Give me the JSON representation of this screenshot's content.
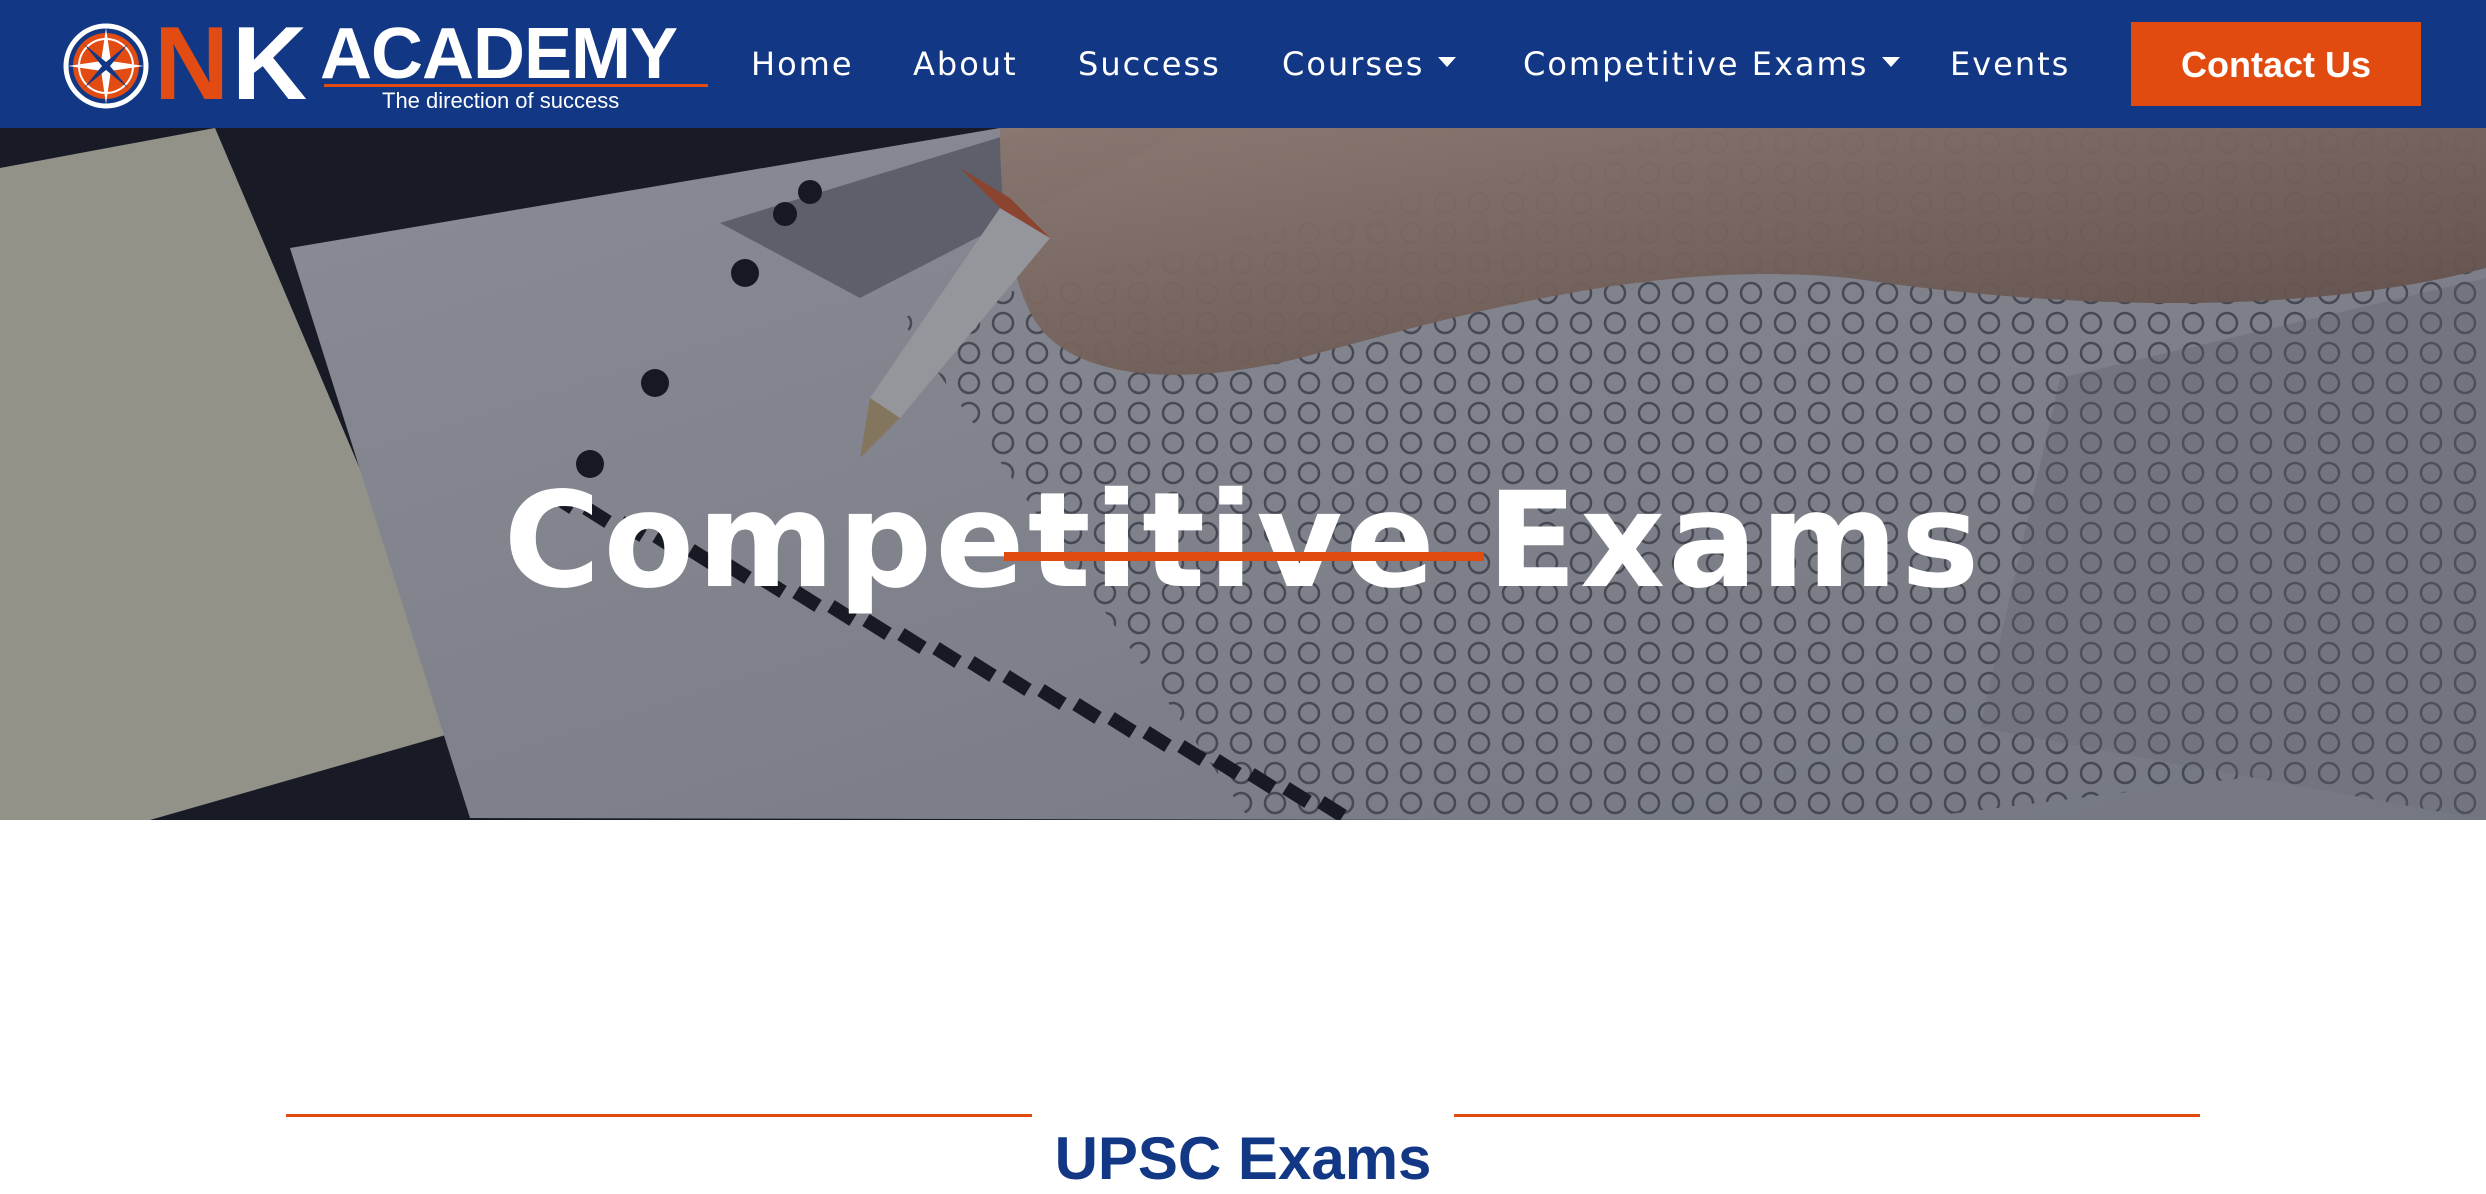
{
  "brand": {
    "letter_n": "N",
    "letter_k": "K",
    "word": "ACADEMY",
    "tagline": "The direction of success",
    "colors": {
      "navy": "#123784",
      "orange": "#e24b0f",
      "white": "#ffffff"
    }
  },
  "nav": {
    "items": [
      {
        "label": "Home"
      },
      {
        "label": "About"
      },
      {
        "label": "Success"
      },
      {
        "label": "Courses",
        "has_dropdown": true
      },
      {
        "label": "Competitive Exams",
        "has_dropdown": true
      },
      {
        "label": "Events"
      }
    ],
    "cta_label": "Contact Us"
  },
  "hero": {
    "title": "Competitive Exams",
    "background_image": "answer-sheet-pencil-photo"
  },
  "section": {
    "title": "UPSC Exams"
  }
}
